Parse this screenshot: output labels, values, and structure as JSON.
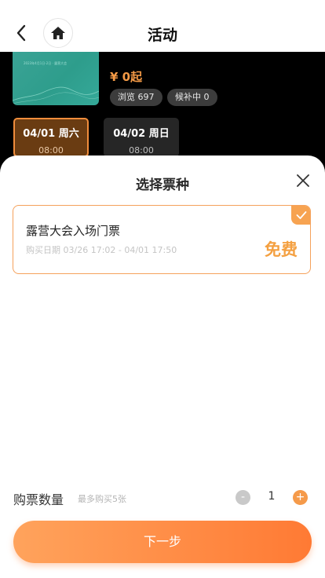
{
  "nav": {
    "title": "活动",
    "back_icon": "chevron-left-icon",
    "home_icon": "home-icon"
  },
  "activity": {
    "thumb_caption": "2023年4月1日-2日 · 露营大会",
    "price": "¥ 0起",
    "views": "浏览 697",
    "waitlist": "候补中 0",
    "dates": [
      {
        "day": "04/01 周六",
        "time": "08:00",
        "selected": true
      },
      {
        "day": "04/02 周日",
        "time": "08:00",
        "selected": false
      }
    ]
  },
  "sheet": {
    "title": "选择票种",
    "close_icon": "close-icon",
    "tickets": [
      {
        "name": "露营大会入场门票",
        "range": "购买日期 03/26 17:02 - 04/01 17:50",
        "price": "免费",
        "selected": true
      }
    ],
    "quantity": {
      "label": "购票数量",
      "note": "最多购买5张",
      "minus": "-",
      "value": "1",
      "plus": "+"
    },
    "next_label": "下一步"
  },
  "colors": {
    "accent": "#f7a351",
    "button_start": "#ffa35c",
    "button_end": "#ff7a34",
    "selected_date_bg": "#6a3c12"
  }
}
